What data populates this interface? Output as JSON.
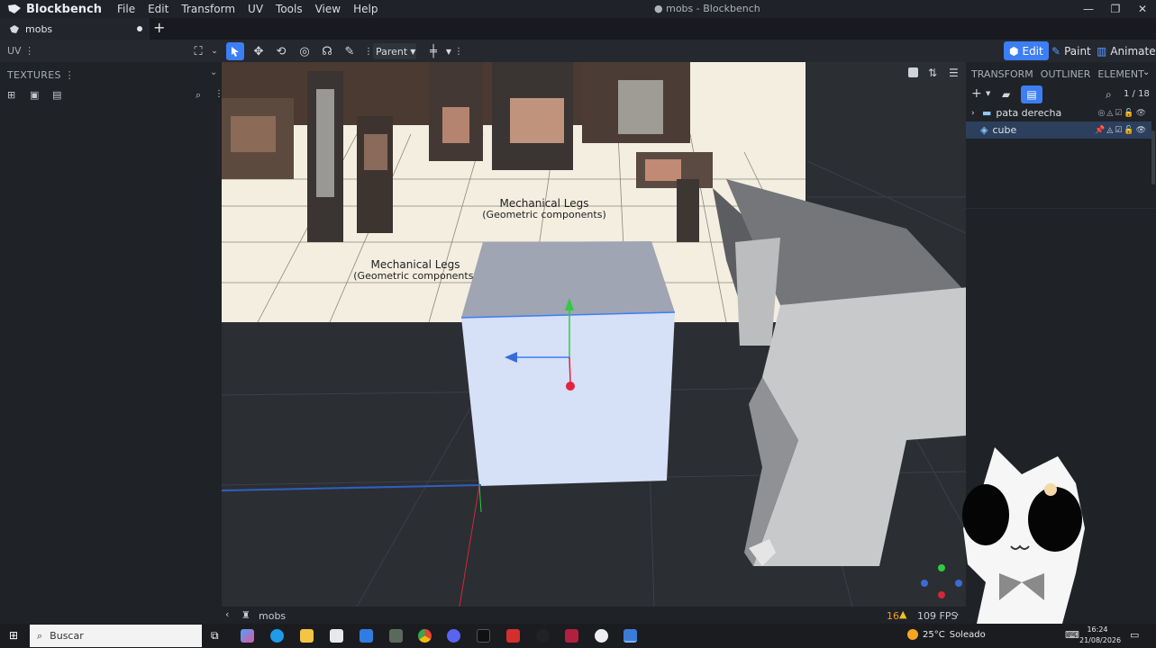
{
  "app": {
    "name": "Blockbench",
    "window_title": "mobs - Blockbench",
    "menu": [
      "File",
      "Edit",
      "Transform",
      "UV",
      "Tools",
      "View",
      "Help"
    ]
  },
  "tabs": [
    {
      "label": "mobs"
    }
  ],
  "toolbar": {
    "uv_label": "UV",
    "parent_label": "Parent",
    "modes": [
      "Edit",
      "Paint",
      "Animate"
    ]
  },
  "left_panel": {
    "title": "TEXTURES"
  },
  "right_panel": {
    "tabs": [
      "TRANSFORM",
      "OUTLINER",
      "ELEMENT"
    ],
    "count": "1 / 18",
    "outliner": [
      {
        "label": "pata derecha",
        "type": "folder"
      },
      {
        "label": "cube",
        "type": "cube",
        "selected": true
      }
    ]
  },
  "viewport": {
    "reference_labels": [
      {
        "line1": "Mechanical Legs",
        "line2": "(Geometric components)"
      },
      {
        "line1": "Mechanical Legs",
        "line2": "(Geometric components)"
      }
    ]
  },
  "status": {
    "project": "mobs",
    "warnings": "16",
    "fps": "109 FPS"
  },
  "taskbar": {
    "search_placeholder": "Buscar",
    "weather": "25°C",
    "weather_desc": "Soleado",
    "time": "16:24",
    "date": "21/08/2026"
  },
  "colors": {
    "accent": "#3c7ef4",
    "cube_face": "#d6e0f7",
    "cube_top": "#9fa5b2"
  }
}
